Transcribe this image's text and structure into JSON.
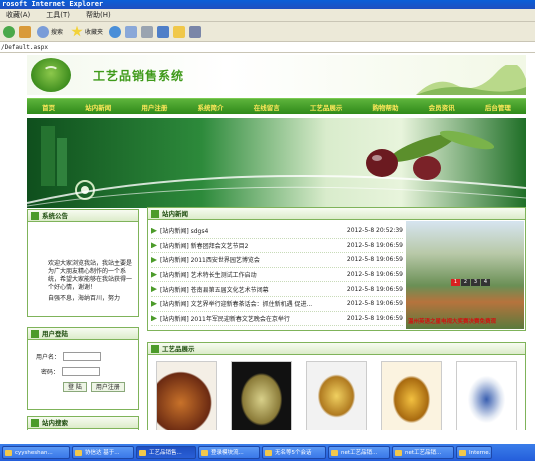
{
  "window": {
    "title": "rosoft Internet Explorer"
  },
  "menu": {
    "items": [
      "收藏(A)",
      "工具(T)",
      "帮助(H)"
    ]
  },
  "toolbar": {
    "search_label": "搜索",
    "favorites_label": "收藏夹"
  },
  "address": {
    "url": "/Default.aspx"
  },
  "site": {
    "title": "工艺品销售系统"
  },
  "nav": {
    "items": [
      "首页",
      "站内新闻",
      "用户注册",
      "系统简介",
      "在线留言",
      "工艺品展示",
      "购物帮助",
      "会员资讯",
      "后台管理"
    ]
  },
  "notice": {
    "heading": "系统公告",
    "lines": [
      "欢迎大家浏览我站，我站主要是为广大朋友精心制作的一个系统，希望大家能够在我站获得一个好心情，谢谢！",
      "自强不息，海纳百川，努力"
    ]
  },
  "login": {
    "heading": "用户登陆",
    "username_label": "用户名：",
    "password_label": "密码：",
    "login_button": "登 陆",
    "register_button": "用户注册"
  },
  "search_box": {
    "heading": "站内搜索"
  },
  "news": {
    "heading": "站内新闻",
    "items": [
      {
        "title": "[站内新闻] sdgs4",
        "date": "2012-5-8 20:52:39"
      },
      {
        "title": "[站内新闻] 新春团拜会文艺节目2",
        "date": "2012-5-8 19:06:59"
      },
      {
        "title": "[站内新闻] 2011西安世界园艺博览会",
        "date": "2012-5-8 19:06:59"
      },
      {
        "title": "[站内新闻] 艺术特长生测试工作启动",
        "date": "2012-5-8 19:06:59"
      },
      {
        "title": "[站内新闻] 苍南县第五届文化艺术节闭幕",
        "date": "2012-5-8 19:06:59"
      },
      {
        "title": "[站内新闻] 文艺界举行迎新春茶话会：抓住新机遇 促进...",
        "date": "2012-5-8 19:06:59"
      },
      {
        "title": "[站内新闻] 2011年军民迎新春文艺晚会在京举行",
        "date": "2012-5-8 19:06:59"
      }
    ],
    "slider_numbers": [
      "1",
      "2",
      "3",
      "4"
    ],
    "photo_caption": "温州英语之星电视大奖赛决赛免费观"
  },
  "crafts": {
    "heading": "工艺品展示"
  },
  "taskbar": {
    "items": [
      "cyysheshan...",
      "协信达 基于...",
      "工艺品销售...",
      "登录模块流...",
      "无名等5个会话",
      "net工艺品销...",
      "net工艺品销...",
      "Interne..."
    ]
  },
  "colors": {
    "brand_green": "#3f9a1a",
    "nav_text": "#ffe85a"
  }
}
